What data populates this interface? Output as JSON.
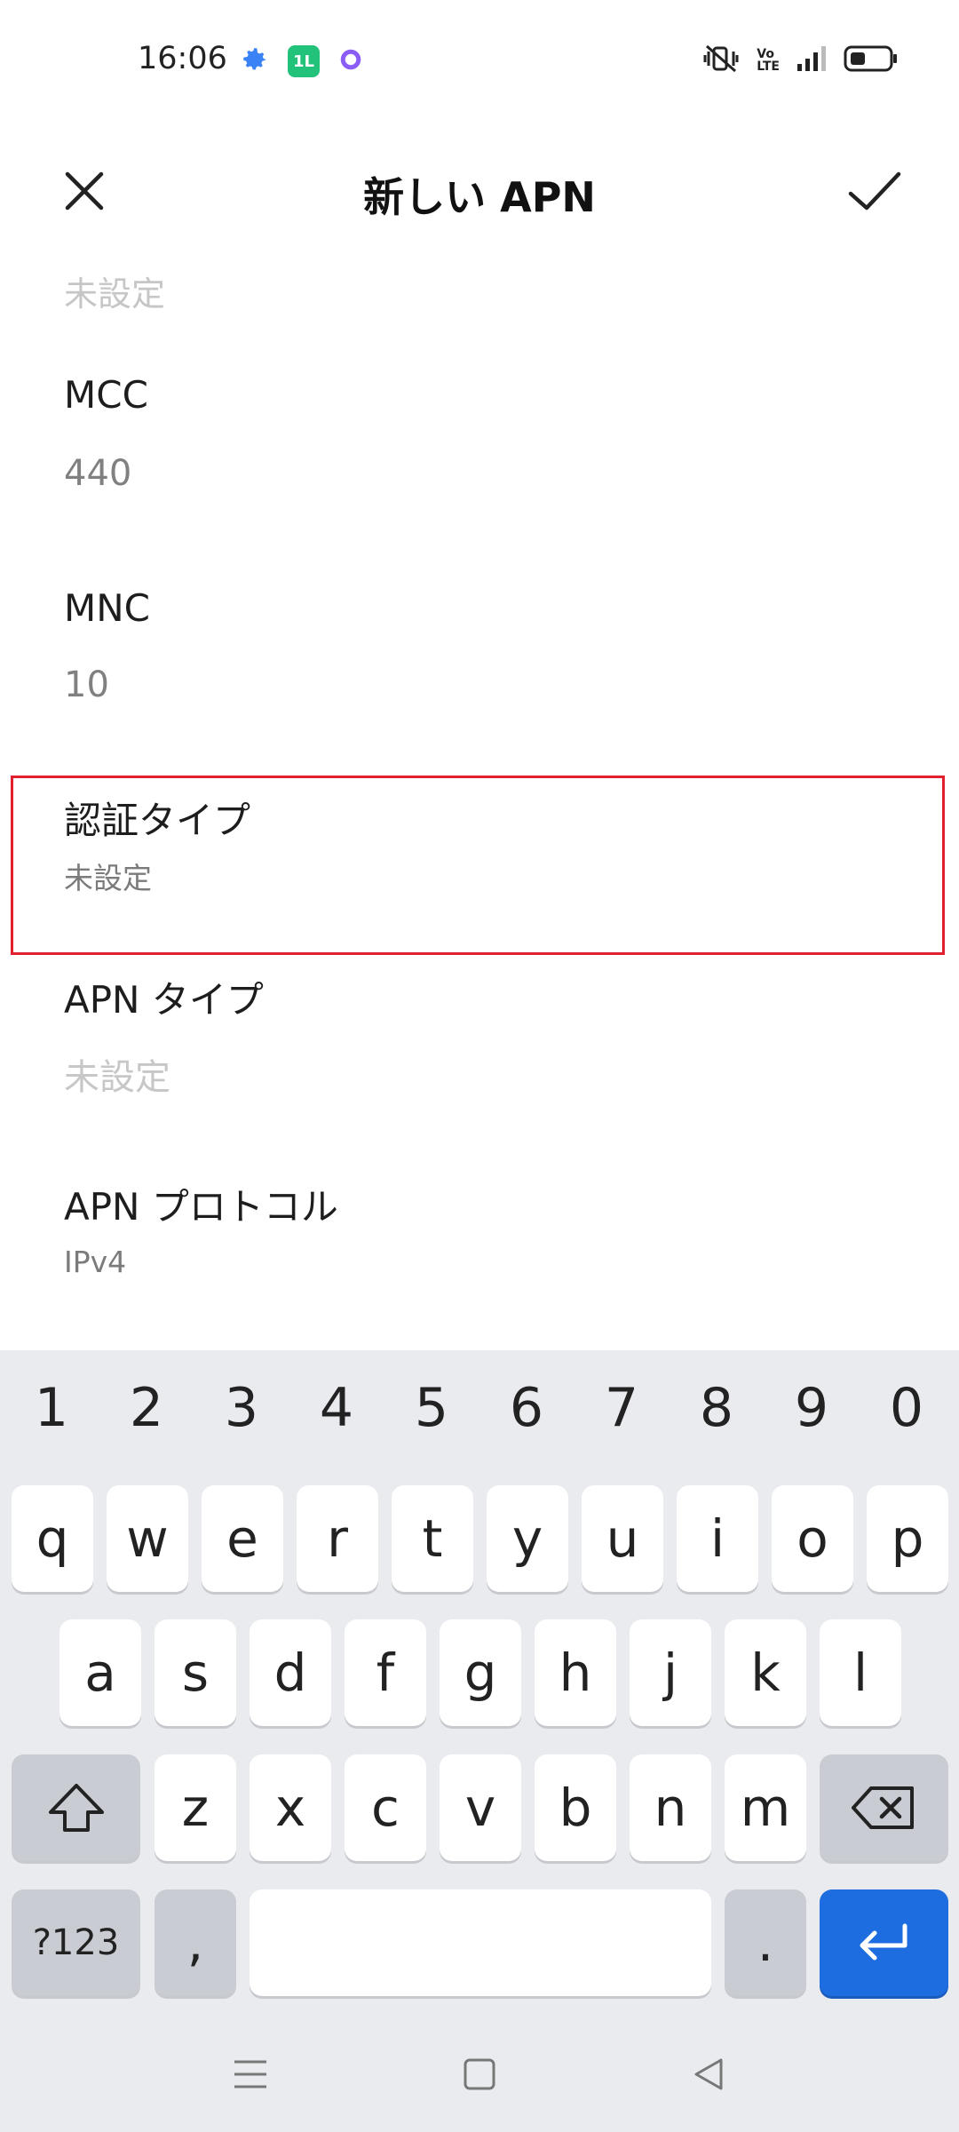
{
  "status": {
    "time": "16:06",
    "left_icons": [
      "gear-icon",
      "app-badge-icon",
      "ring-icon"
    ],
    "right_icons": [
      "vibrate-mute-icon",
      "volte-icon",
      "signal-icon",
      "battery-icon"
    ],
    "volte_top": "Vo",
    "volte_bottom": "LTE",
    "app_badge_text": "1L"
  },
  "header": {
    "title": "新しい APN",
    "close_icon": "close-icon",
    "confirm_icon": "check-icon"
  },
  "fields": {
    "top_partial_value": "未設定",
    "mcc": {
      "label": "MCC",
      "value": "440"
    },
    "mnc": {
      "label": "MNC",
      "value": "10"
    },
    "auth_type": {
      "label": "認証タイプ",
      "value": "未設定"
    },
    "apn_type": {
      "label": "APN タイプ",
      "value": "未設定"
    },
    "apn_protocol": {
      "label": "APN プロトコル",
      "value": "IPv4"
    }
  },
  "keyboard": {
    "numbers": [
      "1",
      "2",
      "3",
      "4",
      "5",
      "6",
      "7",
      "8",
      "9",
      "0"
    ],
    "row1": [
      "q",
      "w",
      "e",
      "r",
      "t",
      "y",
      "u",
      "i",
      "o",
      "p"
    ],
    "row2": [
      "a",
      "s",
      "d",
      "f",
      "g",
      "h",
      "j",
      "k",
      "l"
    ],
    "row3": [
      "z",
      "x",
      "c",
      "v",
      "b",
      "n",
      "m"
    ],
    "symbols_label": "?123",
    "comma_label": ",",
    "period_label": ".",
    "shift_icon": "shift-icon",
    "backspace_icon": "backspace-icon",
    "enter_icon": "enter-icon"
  },
  "navbar": {
    "icons": [
      "menu-icon",
      "home-icon",
      "back-icon"
    ]
  },
  "colors": {
    "highlight": "#e0202e",
    "enter_key": "#1d6de0",
    "keyboard_bg": "#e9ebef"
  }
}
